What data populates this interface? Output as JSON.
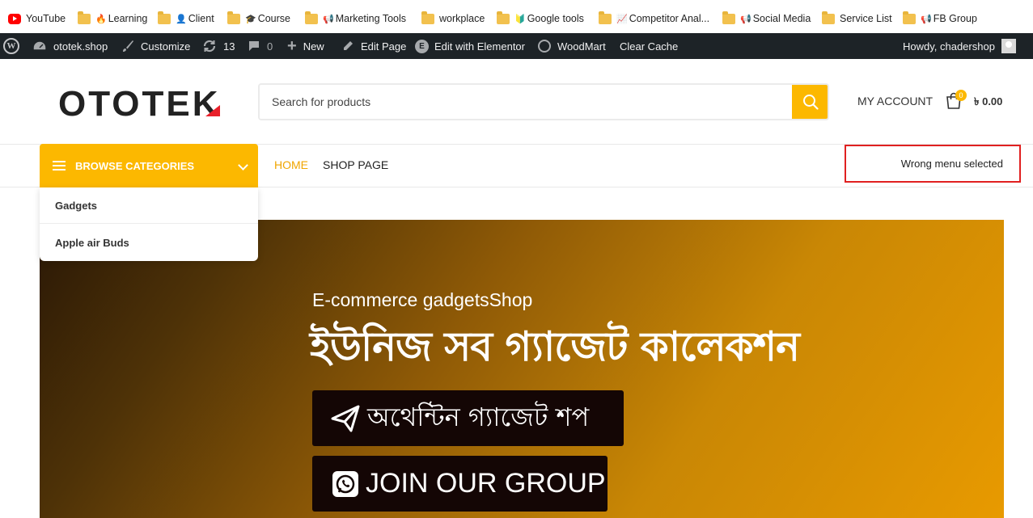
{
  "bookmarks": [
    {
      "label": "YouTube",
      "icon": "youtube-icon"
    },
    {
      "label": "Learning",
      "icon": "folder-icon",
      "emoji": "🔥"
    },
    {
      "label": "Client",
      "icon": "folder-icon",
      "emoji": "👤"
    },
    {
      "label": "Course",
      "icon": "folder-icon",
      "emoji": "🎓"
    },
    {
      "label": "Marketing Tools",
      "icon": "folder-icon",
      "emoji": "📢"
    },
    {
      "label": "workplace",
      "icon": "folder-icon"
    },
    {
      "label": "Google tools",
      "icon": "folder-icon",
      "emoji": "🔰"
    },
    {
      "label": "Competitor Anal...",
      "icon": "folder-icon",
      "emoji": "📈"
    },
    {
      "label": "Social Media",
      "icon": "folder-icon",
      "emoji": "📢"
    },
    {
      "label": "Service List",
      "icon": "folder-icon"
    },
    {
      "label": "FB Group",
      "icon": "folder-icon",
      "emoji": "📢"
    }
  ],
  "admin_bar": {
    "site": "ototek.shop",
    "customize": "Customize",
    "updates": "13",
    "comments": "0",
    "new": "New",
    "edit_page": "Edit Page",
    "elementor": "Edit with Elementor",
    "woodmart": "WoodMart",
    "clear_cache": "Clear Cache",
    "howdy": "Howdy, chadershop"
  },
  "header": {
    "logo": "OTOTEK",
    "search_placeholder": "Search for products",
    "my_account": "MY ACCOUNT",
    "cart_count": "0",
    "cart_total": "৳ 0.00"
  },
  "nav": {
    "browse_label": "BROWSE CATEGORIES",
    "links": [
      "HOME",
      "SHOP PAGE"
    ],
    "annotation": "Wrong menu selected"
  },
  "categories": [
    "Gadgets",
    "Apple air Buds"
  ],
  "hero": {
    "subtitle": "E-commerce gadgetsShop",
    "title": "ইউনিজ সব গ্যাজেট কালেকশন",
    "button1": "অথেন্টিন গ্যাজেট শপ",
    "button2": "JOIN OUR GROUP"
  },
  "colors": {
    "accent": "#fcb800",
    "admin_bar": "#1d2327",
    "annotation_border": "#e02020",
    "button_bg": "#140605"
  }
}
